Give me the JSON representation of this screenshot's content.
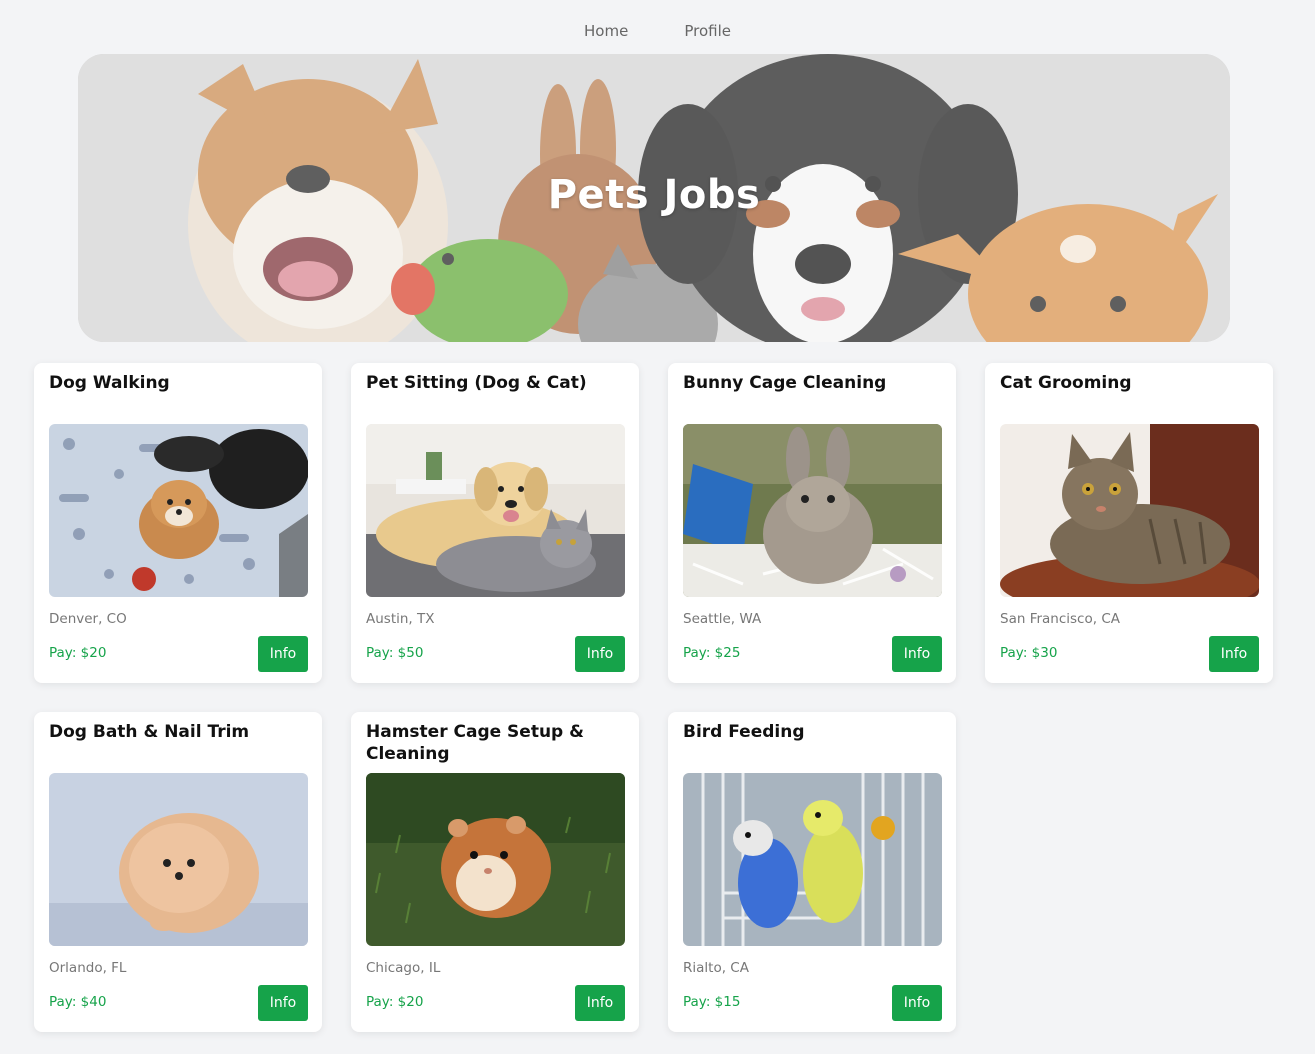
{
  "nav": {
    "home": "Home",
    "profile": "Profile"
  },
  "hero": {
    "title": "Pets Jobs"
  },
  "button_label": "Info",
  "accent": "#16a34a",
  "jobs": [
    {
      "title": "Dog Walking",
      "location": "Denver, CO",
      "pay": "Pay: $20",
      "image": "puppies-on-blanket"
    },
    {
      "title": "Pet Sitting (Dog & Cat)",
      "location": "Austin, TX",
      "pay": "Pay: $50",
      "image": "golden-retriever-and-cat"
    },
    {
      "title": "Bunny Cage Cleaning",
      "location": "Seattle, WA",
      "pay": "Pay: $25",
      "image": "rabbit-in-cage"
    },
    {
      "title": "Cat Grooming",
      "location": "San Francisco, CA",
      "pay": "Pay: $30",
      "image": "tabby-cat"
    },
    {
      "title": "Dog Bath & Nail Trim",
      "location": "Orlando, FL",
      "pay": "Pay: $40",
      "image": "pomeranian-puppy"
    },
    {
      "title": "Hamster Cage Setup & Cleaning",
      "location": "Chicago, IL",
      "pay": "Pay: $20",
      "image": "hamster-on-grass"
    },
    {
      "title": "Bird Feeding",
      "location": "Rialto, CA",
      "pay": "Pay: $15",
      "image": "budgies-in-cage"
    }
  ]
}
